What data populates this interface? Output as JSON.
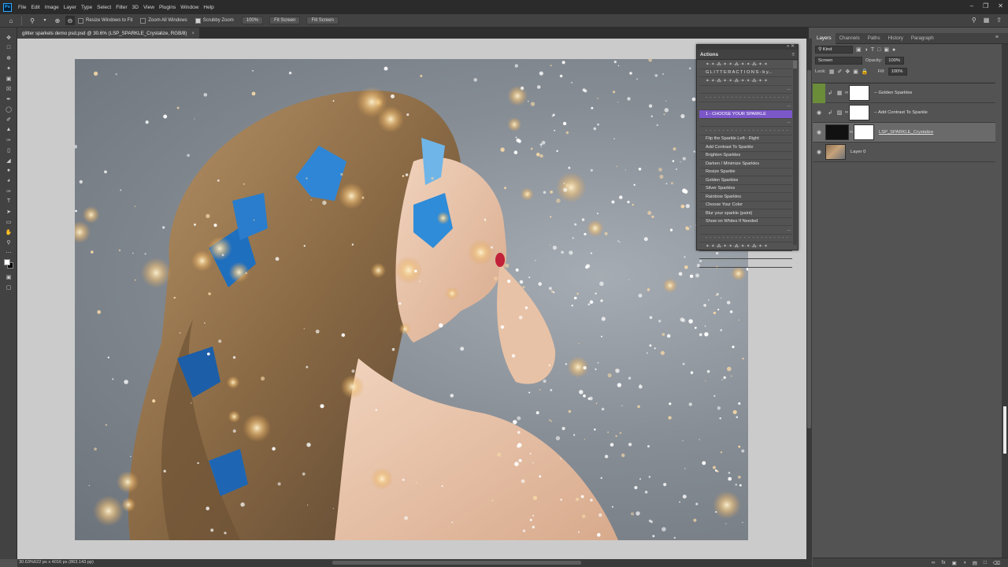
{
  "menubar": {
    "items": [
      "File",
      "Edit",
      "Image",
      "Layer",
      "Type",
      "Select",
      "Filter",
      "3D",
      "View",
      "Plugins",
      "Window",
      "Help"
    ],
    "logo": "Ps"
  },
  "options": {
    "resize_windows": "Resize Windows to Fit",
    "zoom_all": "Zoom All Windows",
    "scrubby_zoom": "Scrubby Zoom",
    "zoom_pct": "100%",
    "fit_screen": "Fit Screen",
    "fill_screen": "Fill Screen"
  },
  "document": {
    "tab_title": "glitter sparkels demo psd.psd @ 30.6% (LSP_SPARKLE_Crystalize, RGB/8)",
    "close": "×"
  },
  "status": {
    "text": "30.63%622 px x 4016 px (863.143 pp)"
  },
  "actions_panel": {
    "title": "Actions",
    "rows": [
      {
        "text": "✶·✴·⁂·✶·✴·⁂·✶·✴·⁂·✶·✴",
        "kind": "dots"
      },
      {
        "text": "G L I T T E R  A C T I O N S  -  b y...",
        "kind": "normal"
      },
      {
        "text": "✶·✴·⁂·✶·✴·⁂·✶·✴·⁂·✶·✴",
        "kind": "dots"
      },
      {
        "text": "",
        "kind": "ell"
      },
      {
        "text": "- - - - - - - - - - - - - - - - - - - -",
        "kind": "dash"
      },
      {
        "text": "",
        "kind": "ell"
      },
      {
        "text": "1 - CHOOSE YOUR SPARKLE",
        "kind": "highlight"
      },
      {
        "text": "",
        "kind": "ell"
      },
      {
        "text": "- - - - - - - - - - - - - - - - - - - -",
        "kind": "dash"
      },
      {
        "text": "Flip the Sparkle Left - Right",
        "kind": "normal"
      },
      {
        "text": "Add Contrast To Sparkle",
        "kind": "normal"
      },
      {
        "text": "Brighten Sparkles",
        "kind": "normal"
      },
      {
        "text": "Darken / Minimize Sparkles",
        "kind": "normal"
      },
      {
        "text": "Resize Sparkle",
        "kind": "normal"
      },
      {
        "text": "Golden Sparkles",
        "kind": "normal"
      },
      {
        "text": "Silver Sparkles",
        "kind": "normal"
      },
      {
        "text": "Rainbow Sparkles",
        "kind": "normal"
      },
      {
        "text": "Choose Your Color",
        "kind": "normal"
      },
      {
        "text": "Blur your sparkle (paint)",
        "kind": "normal"
      },
      {
        "text": "Show on Whites If Needed",
        "kind": "normal"
      },
      {
        "text": "",
        "kind": "ell"
      },
      {
        "text": "- - - - - - - - - - - - - - - - - - - -",
        "kind": "dash"
      },
      {
        "text": "✶·✴·⁂·✶·✴·⁂·✶·✴·⁂·✶·✴",
        "kind": "dots"
      },
      {
        "text": "",
        "kind": "ell"
      },
      {
        "text": "",
        "kind": "ell"
      }
    ],
    "highlight_color": "#7b57c8"
  },
  "layers_panel": {
    "tabs": [
      "Layers",
      "Channels",
      "Paths",
      "History",
      "Paragraph"
    ],
    "active_tab": "Layers",
    "filter_kind": "Kind",
    "blend_mode": "Screen",
    "opacity_label": "Opacity:",
    "opacity": "100%",
    "lock_label": "Lock:",
    "fill_label": "Fill:",
    "fill": "100%",
    "layers": [
      {
        "name": "-- Golden Sparkles",
        "visible": false,
        "thumb": "white",
        "adjust": "curves"
      },
      {
        "name": "-- Add Contrast To Sparkle",
        "visible": true,
        "thumb": "white",
        "adjust": "levels"
      },
      {
        "name": "LSP_SPARKLE_Crystalize",
        "visible": true,
        "thumb": "dark",
        "selected": true
      },
      {
        "name": "Layer 0",
        "visible": true,
        "thumb": "photo"
      }
    ]
  }
}
